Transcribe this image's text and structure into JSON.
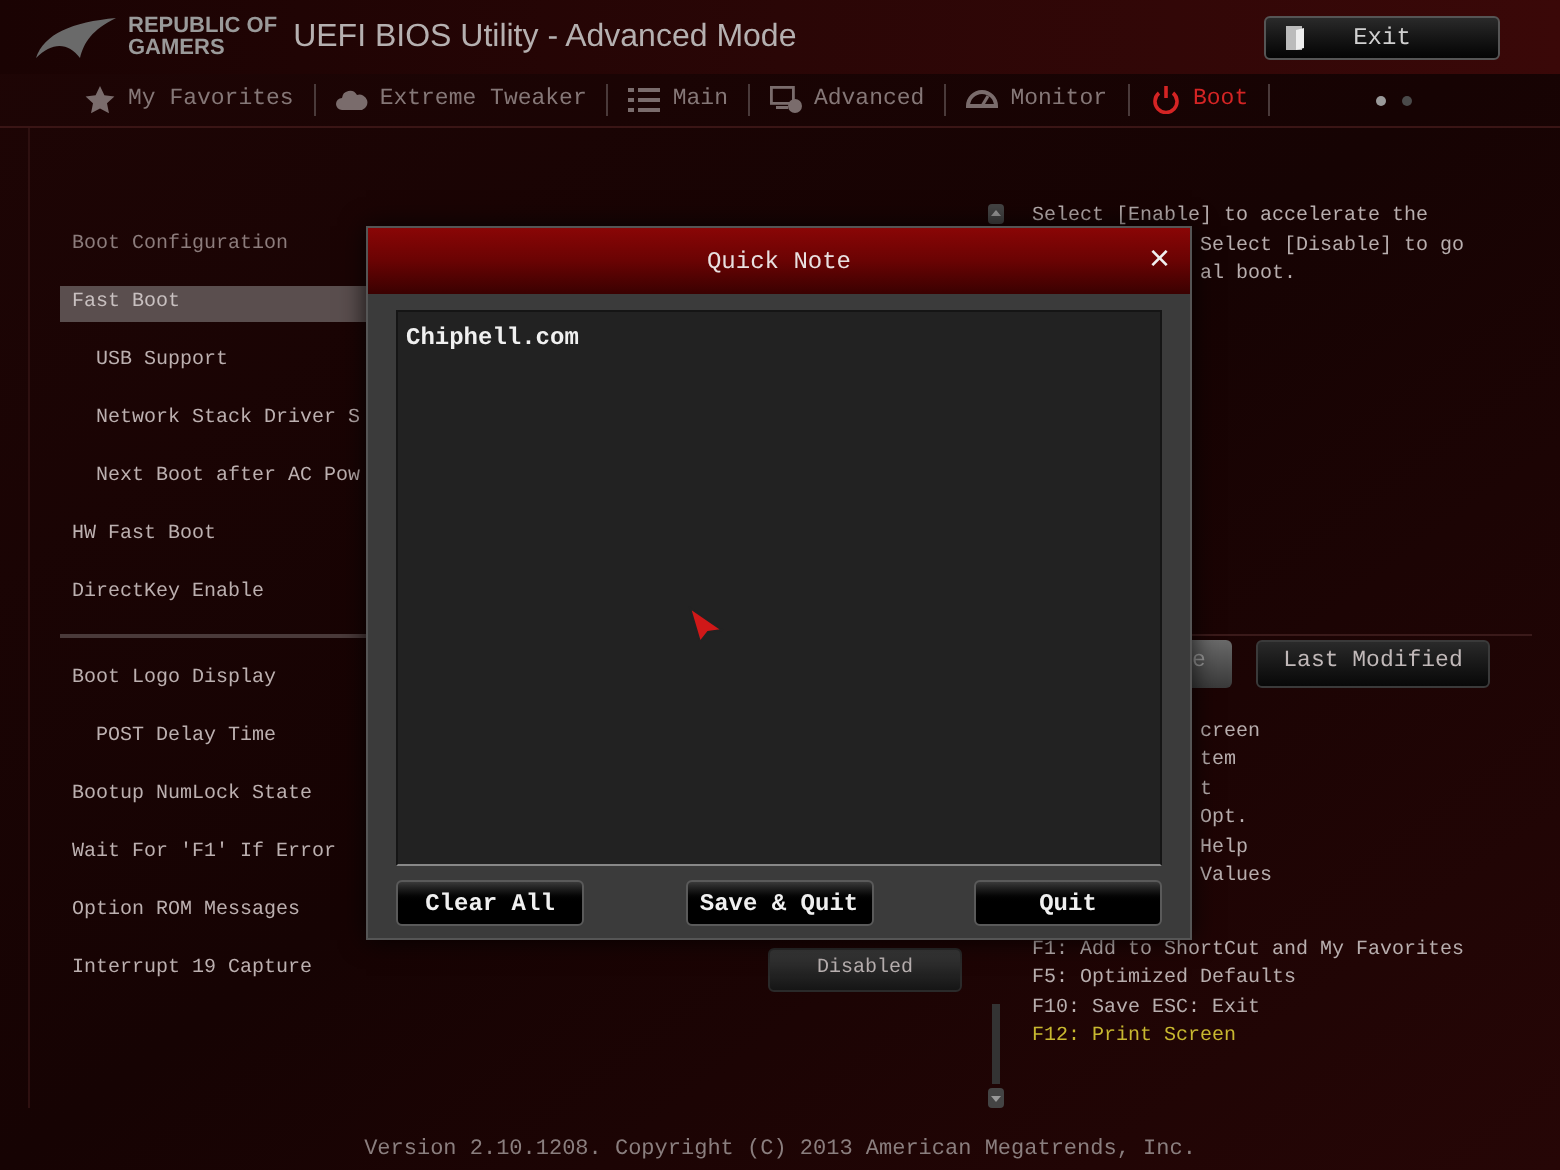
{
  "header": {
    "logo_line_1": "REPUBLIC OF",
    "logo_line_2": "GAMERS",
    "title": "UEFI BIOS Utility - Advanced Mode",
    "exit_button": "Exit"
  },
  "tabs": [
    {
      "label": "My Favorites",
      "kind": "star",
      "selected": false
    },
    {
      "label": "Extreme Tweaker",
      "kind": "cloud",
      "selected": false
    },
    {
      "label": "Main",
      "kind": "list",
      "selected": false
    },
    {
      "label": "Advanced",
      "kind": "screen",
      "selected": false
    },
    {
      "label": "Monitor",
      "kind": "gauge",
      "selected": false
    },
    {
      "label": "Boot",
      "kind": "power",
      "selected": true
    }
  ],
  "pages": [
    {
      "selected": true
    },
    {
      "selected": false
    }
  ],
  "settings": [
    {
      "kind": "heading",
      "label": "Boot Configuration",
      "selected": false
    },
    {
      "kind": "item",
      "label": "Fast Boot",
      "selected": true,
      "children": [
        {
          "kind": "item",
          "label": "USB Support",
          "selected": false
        },
        {
          "kind": "item",
          "label": "Network Stack Driver S",
          "selected": false
        },
        {
          "kind": "item",
          "label": "Next Boot after AC Pow",
          "selected": false
        }
      ]
    },
    {
      "kind": "item",
      "label": "HW Fast Boot",
      "selected": false
    },
    {
      "kind": "item",
      "label": "DirectKey Enable",
      "selected": false
    },
    {
      "kind": "divider"
    },
    {
      "kind": "item",
      "label": "Boot Logo Display",
      "selected": false,
      "children": [
        {
          "kind": "item",
          "label": "POST Delay Time",
          "selected": false
        }
      ]
    },
    {
      "kind": "item",
      "label": "Bootup NumLock State",
      "selected": false
    },
    {
      "kind": "item",
      "label": "Wait For 'F1' If Error",
      "selected": false
    },
    {
      "kind": "item",
      "label": "Option ROM Messages",
      "selected": false
    },
    {
      "kind": "item",
      "label": "Interrupt 19 Capture",
      "selected": false,
      "value": "Disabled"
    }
  ],
  "help": {
    "line": "Select [Enable] to accelerate the",
    "partial_lines": [
      "Select [Disable] to go",
      "al boot."
    ]
  },
  "partial_button": "e",
  "last_modified_button": "Last Modified",
  "partial_hotkeys": [
    "creen",
    "tem",
    "t",
    "Opt.",
    "Help",
    "Values"
  ],
  "hotkeys": [
    {
      "text": "F1: Add to ShortCut and My Favorites",
      "highlight": false
    },
    {
      "text": "F5: Optimized Defaults",
      "highlight": false
    },
    {
      "text": "F10: Save  ESC: Exit",
      "highlight": false
    },
    {
      "text": "F12: Print Screen",
      "highlight": true
    }
  ],
  "footer": "Version 2.10.1208. Copyright (C) 2013 American Megatrends, Inc.",
  "dialog": {
    "title": "Quick Note",
    "close": "×",
    "note": "Chiphell.com",
    "buttons": [
      "Clear All",
      "Save & Quit",
      "Quit"
    ]
  }
}
